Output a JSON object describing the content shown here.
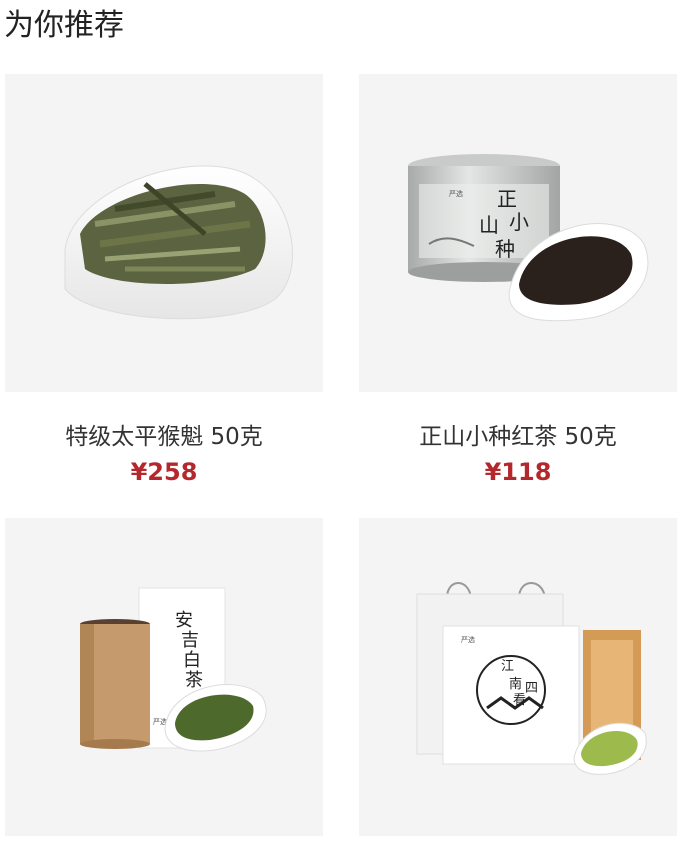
{
  "section": {
    "title": "为你推荐"
  },
  "products": [
    {
      "name": "特级太平猴魁 50克",
      "price": "¥258",
      "image": "taiping-houkui-tea-in-white-scoop"
    },
    {
      "name": "正山小种红茶 50克",
      "price": "¥118",
      "image": "zhengshan-xiaozhong-tin-with-black-tea",
      "tin_label": [
        "正",
        "山",
        "小",
        "种"
      ],
      "tin_brand": "严选"
    },
    {
      "name": "",
      "price": "",
      "image": "anji-baicha-kraft-tube-with-green-tea",
      "box_label": [
        "安",
        "吉",
        "白",
        "茶"
      ],
      "box_brand": "严选"
    },
    {
      "name": "",
      "price": "",
      "image": "jiangnan-tea-gift-bag-with-bamboo-box",
      "bag_label": [
        "江",
        "南",
        "四",
        "看"
      ],
      "bag_brand": "严选"
    }
  ],
  "colors": {
    "accent_price": "#b4282d",
    "thumb_bg": "#f4f4f4"
  }
}
